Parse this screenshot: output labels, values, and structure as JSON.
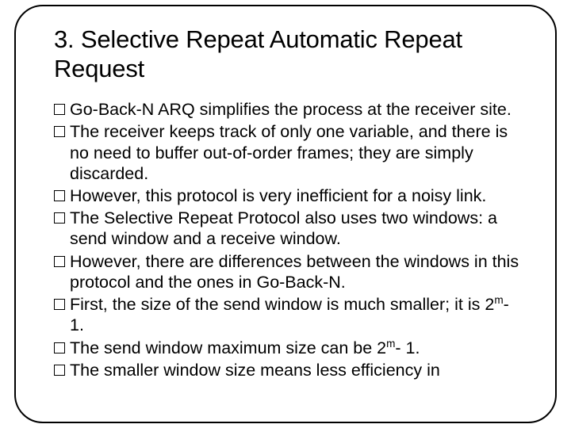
{
  "title": "3. Selective Repeat Automatic Repeat Request",
  "bullets": [
    {
      "pre": "Go-Back-N ARQ simplifies the process at the receiver site."
    },
    {
      "pre": "The receiver keeps track of only one variable, and there is no need to buffer out-of-order frames; they are simply discarded."
    },
    {
      "pre": "However, this protocol is very inefficient for a noisy link."
    },
    {
      "pre": "The Selective Repeat Protocol also uses two windows: a send window and a receive window."
    },
    {
      "pre": "However, there are differences between the windows in this protocol and the ones in Go-Back-N."
    },
    {
      "pre": "First, the size of the send window is much smaller; it is 2",
      "sup": "m",
      "post": "- 1."
    },
    {
      "pre": "The send window maximum size can be 2",
      "sup": "m",
      "post": "- 1."
    },
    {
      "pre": "The smaller window size means less efficiency in"
    }
  ]
}
